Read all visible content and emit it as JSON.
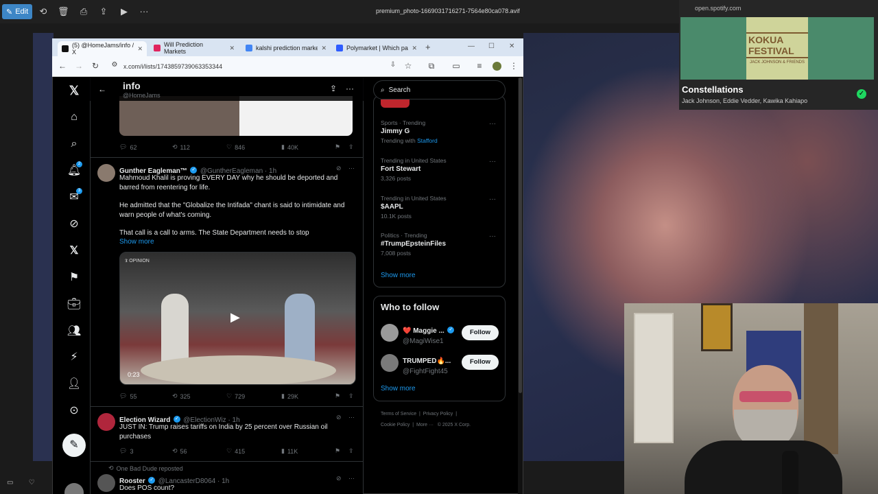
{
  "viewer": {
    "edit_label": "Edit",
    "file_title": "premium_photo-1669031716271-7564e80ca078.avif"
  },
  "spotify": {
    "domain": "open.spotify.com",
    "album_art_text": "KOKUA FESTIVAL",
    "album_art_sub": "JACK JOHNSON & FRIENDS",
    "title": "Constellations",
    "artists": "Jack Johnson, Eddie Vedder, Kawika Kahiapo",
    "accent": "#1ed760"
  },
  "browser": {
    "tabs": [
      {
        "label": "(5) @HomeJams/info / X",
        "color": "#111111"
      },
      {
        "label": "Will Prediction Markets",
        "color": "#e0245e"
      },
      {
        "label": "kalshi prediction market",
        "color": "#4285f4"
      },
      {
        "label": "Polymarket | Which part",
        "color": "#2e5cff"
      }
    ],
    "url": "x.com/i/lists/1743859739063353344"
  },
  "x": {
    "list_title": "info",
    "list_handle": "@HomeJams",
    "nav_badges": {
      "notifications": "2",
      "messages": "3"
    },
    "posts": [
      {
        "stats": {
          "replies": "62",
          "reposts": "112",
          "likes": "846",
          "views": "40K"
        }
      },
      {
        "name": "Gunther Eagleman™",
        "handle": "@GuntherEagleman · 1h",
        "text1": "Mahmoud Khalil is proving EVERY DAY why he should be deported and barred from reentering for life.",
        "text2": "He admitted that the \"Globalize the Intifada\" chant is said to intimidate and warn people of what's coming.",
        "text3": "That call is a call to arms. The State Department needs to stop",
        "show_more": "Show more",
        "video_tag": "OPINION",
        "video_time": "0:23",
        "stats": {
          "replies": "55",
          "reposts": "325",
          "likes": "729",
          "views": "29K"
        }
      },
      {
        "name": "Election Wizard",
        "handle": "@ElectionWiz · 1h",
        "text1": "JUST IN: Trump raises tariffs on India by 25 percent over Russian oil purchases",
        "stats": {
          "replies": "3",
          "reposts": "56",
          "likes": "415",
          "views": "11K"
        }
      },
      {
        "repost_note": "One Bad Dude reposted",
        "name": "Rooster",
        "handle": "@LancasterD8064 · 1h",
        "text1": "Does POS count?"
      }
    ],
    "search_placeholder": "Search",
    "trends": [
      {
        "category": "Sports · Trending",
        "name": "Jimmy G",
        "count": "Trending with",
        "with": "Stafford"
      },
      {
        "category": "Trending in United States",
        "name": "Fort Stewart",
        "count": "3,326 posts"
      },
      {
        "category": "Trending in United States",
        "name": "$AAPL",
        "count": "10.1K posts"
      },
      {
        "category": "Politics · Trending",
        "name": "#TrumpEpsteinFiles",
        "count": "7,008 posts"
      }
    ],
    "show_more": "Show more",
    "who_to_follow": {
      "title": "Who to follow",
      "users": [
        {
          "name": "❤️ Maggie ...",
          "handle": "@MagiWise1",
          "button": "Follow"
        },
        {
          "name": "TRUMPED🔥...",
          "handle": "@FightFight45",
          "button": "Follow"
        }
      ],
      "show_more": "Show more"
    },
    "footer": {
      "terms": "Terms of Service",
      "privacy": "Privacy Policy",
      "cookie": "Cookie Policy",
      "more": "More ···",
      "copyright": "© 2025 X Corp."
    }
  }
}
